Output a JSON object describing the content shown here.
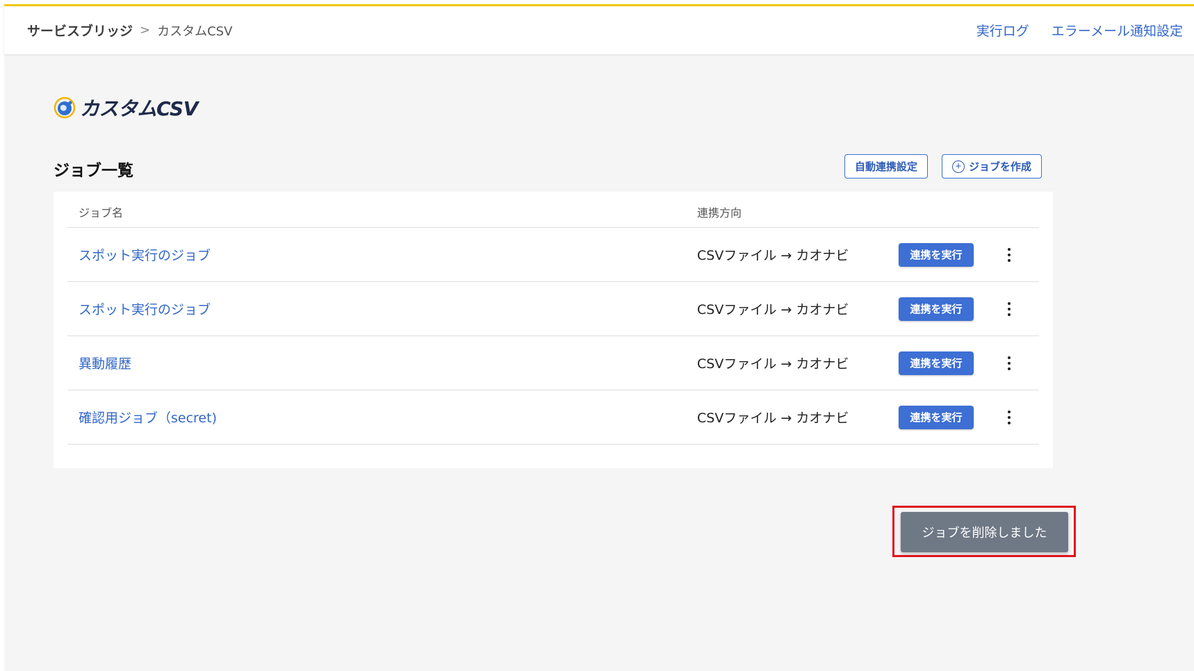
{
  "header": {
    "breadcrumb_root": "サービスブリッジ",
    "breadcrumb_separator": ">",
    "breadcrumb_current": "カスタムCSV",
    "links": [
      "実行ログ",
      "エラーメール通知設定"
    ]
  },
  "brand": {
    "name": "カスタムCSV"
  },
  "jobs_section": {
    "title": "ジョブ一覧",
    "auto_settings_label": "自動連携設定",
    "create_job_label": "ジョブを作成"
  },
  "table": {
    "columns": [
      "ジョブ名",
      "連携方向"
    ],
    "rows": [
      {
        "name": "スポット実行のジョブ",
        "direction": "CSVファイル → カオナビ",
        "action": "連携を実行"
      },
      {
        "name": "スポット実行のジョブ",
        "direction": "CSVファイル → カオナビ",
        "action": "連携を実行"
      },
      {
        "name": "異動履歴",
        "direction": "CSVファイル → カオナビ",
        "action": "連携を実行"
      },
      {
        "name": "確認用ジョブ（secret)",
        "direction": "CSVファイル → カオナビ",
        "action": "連携を実行"
      }
    ]
  },
  "toast": {
    "message": "ジョブを削除しました"
  },
  "colors": {
    "accent": "#3d6fd4",
    "link": "#3267c8",
    "top_border": "#f2c800",
    "toast_bg": "#6f7885",
    "highlight": "#e0141d"
  }
}
